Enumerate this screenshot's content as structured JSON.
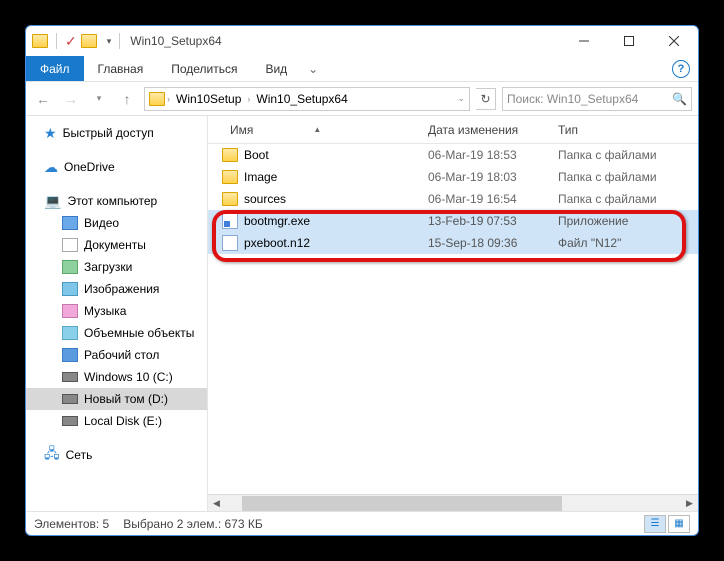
{
  "window": {
    "title": "Win10_Setupx64"
  },
  "ribbon": {
    "file": "Файл",
    "home": "Главная",
    "share": "Поделиться",
    "view": "Вид"
  },
  "breadcrumb": {
    "seg1": "Win10Setup",
    "seg2": "Win10_Setupx64"
  },
  "search": {
    "placeholder": "Поиск: Win10_Setupx64"
  },
  "nav": {
    "quick": "Быстрый доступ",
    "onedrive": "OneDrive",
    "thispc": "Этот компьютер",
    "video": "Видео",
    "documents": "Документы",
    "downloads": "Загрузки",
    "pictures": "Изображения",
    "music": "Музыка",
    "objects3d": "Объемные объекты",
    "desktop": "Рабочий стол",
    "drive_c": "Windows 10 (C:)",
    "drive_d": "Новый том (D:)",
    "drive_e": "Local Disk (E:)",
    "network": "Сеть"
  },
  "columns": {
    "name": "Имя",
    "date": "Дата изменения",
    "type": "Тип"
  },
  "rows": [
    {
      "name": "Boot",
      "date": "06-Mar-19 18:53",
      "type": "Папка с файлами",
      "kind": "folder",
      "selected": false
    },
    {
      "name": "Image",
      "date": "06-Mar-19 18:03",
      "type": "Папка с файлами",
      "kind": "folder",
      "selected": false
    },
    {
      "name": "sources",
      "date": "06-Mar-19 16:54",
      "type": "Папка с файлами",
      "kind": "folder",
      "selected": false
    },
    {
      "name": "bootmgr.exe",
      "date": "13-Feb-19 07:53",
      "type": "Приложение",
      "kind": "exe",
      "selected": true
    },
    {
      "name": "pxeboot.n12",
      "date": "15-Sep-18 09:36",
      "type": "Файл \"N12\"",
      "kind": "file",
      "selected": true
    }
  ],
  "status": {
    "count": "Элементов: 5",
    "selection": "Выбрано 2 элем.: 673 КБ"
  }
}
